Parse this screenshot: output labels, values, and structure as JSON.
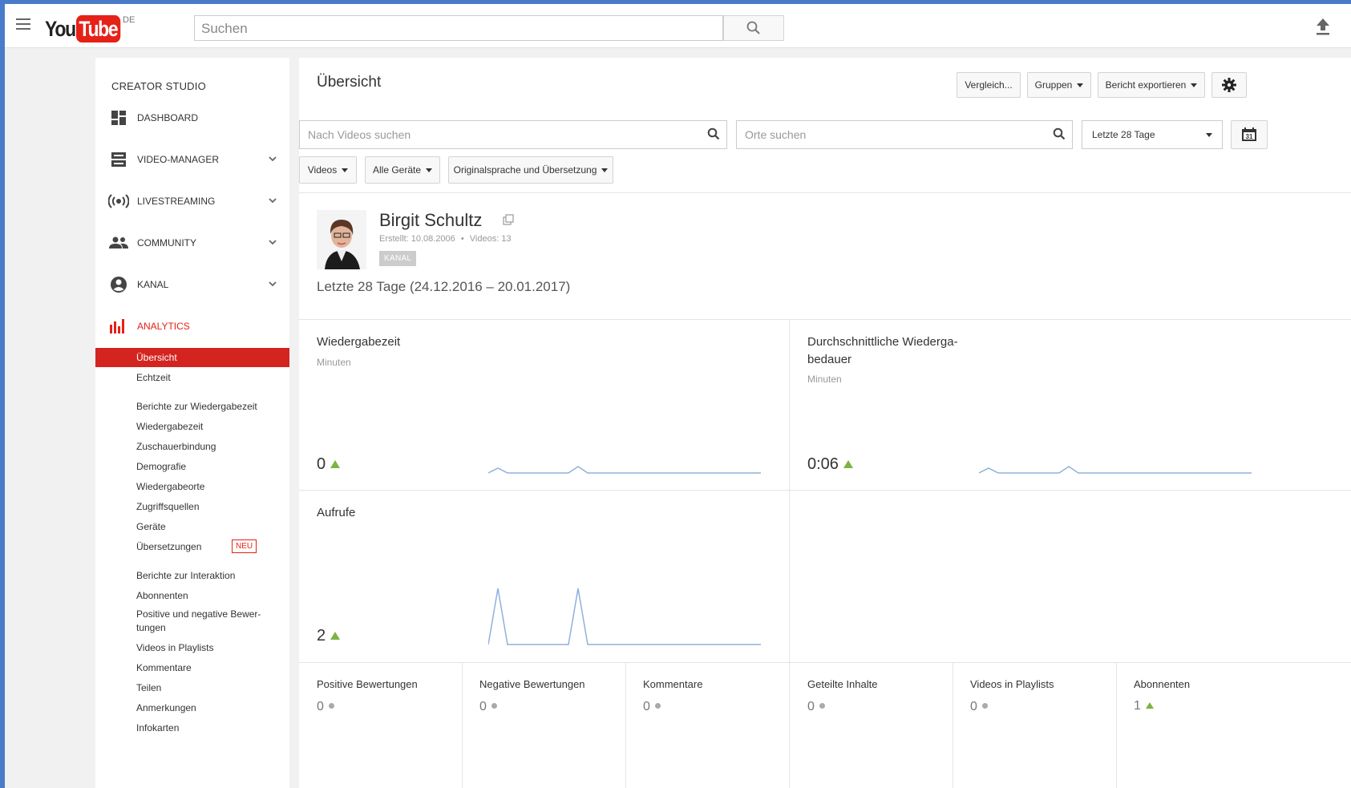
{
  "topbar": {
    "logo_you": "You",
    "logo_tube": "Tube",
    "logo_country": "DE",
    "search_placeholder": "Suchen"
  },
  "sidebar": {
    "heading": "CREATOR STUDIO",
    "items": [
      {
        "label": "DASHBOARD"
      },
      {
        "label": "VIDEO-MANAGER"
      },
      {
        "label": "LIVESTREAMING"
      },
      {
        "label": "COMMUNITY"
      },
      {
        "label": "KANAL"
      },
      {
        "label": "ANALYTICS"
      }
    ],
    "analytics_sub": [
      "Übersicht",
      "Echtzeit",
      "Berichte zur Wiedergabezeit",
      "Wiedergabezeit",
      "Zuschauerbindung",
      "Demografie",
      "Wiedergabeorte",
      "Zugriffsquellen",
      "Geräte",
      "Übersetzungen",
      "Berichte zur Interaktion",
      "Abonnenten",
      "Positive und negative Bewer-",
      "tungen",
      "Videos in Playlists",
      "Kommentare",
      "Teilen",
      "Anmerkungen",
      "Infokarten"
    ],
    "new_badge": "NEU"
  },
  "header": {
    "title": "Übersicht",
    "compare_label": "Vergleich...",
    "groups_label": "Gruppen",
    "export_label": "Bericht exportieren"
  },
  "filters": {
    "video_search_placeholder": "Nach Videos suchen",
    "places_search_placeholder": "Orte suchen",
    "period": "Letzte 28 Tage",
    "calendar_day": "31",
    "videos": "Videos",
    "devices": "Alle Geräte",
    "language": "Originalsprache und Übersetzung"
  },
  "channel": {
    "name": "Birgit Schultz",
    "created": "Erstellt: 10.08.2006",
    "separator": "•",
    "videos": "Videos: 13",
    "badge": "KANAL",
    "range": "Letzte 28 Tage (24.12.2016 – 20.01.2017)"
  },
  "cards": {
    "watch_time": {
      "title": "Wiedergabezeit",
      "unit": "Minuten",
      "value": "0"
    },
    "avg_duration": {
      "title_line1": "Durchschnittliche Wiederga-",
      "title_line2": "bedauer",
      "unit": "Minuten",
      "value": "0:06"
    },
    "views": {
      "title": "Aufrufe",
      "value": "2"
    }
  },
  "stats": [
    {
      "label": "Positive Bewertungen",
      "value": "0",
      "trend": "neutral"
    },
    {
      "label": "Negative Bewertungen",
      "value": "0",
      "trend": "neutral"
    },
    {
      "label": "Kommentare",
      "value": "0",
      "trend": "neutral"
    },
    {
      "label": "Geteilte Inhalte",
      "value": "0",
      "trend": "neutral"
    },
    {
      "label": "Videos in Playlists",
      "value": "0",
      "trend": "neutral"
    },
    {
      "label": "Abonnenten",
      "value": "1",
      "trend": "up"
    }
  ],
  "colors": {
    "accent_red": "#e62117",
    "trend_up": "#7cb342",
    "sparkline": "#8fb0dc"
  },
  "icons": [
    "hamburger-icon",
    "search-icon",
    "upload-icon",
    "dashboard-icon",
    "video-manager-icon",
    "livestream-icon",
    "community-icon",
    "account-icon",
    "analytics-icon",
    "chevron-down-icon",
    "gear-icon",
    "calendar-icon",
    "external-link-icon"
  ]
}
